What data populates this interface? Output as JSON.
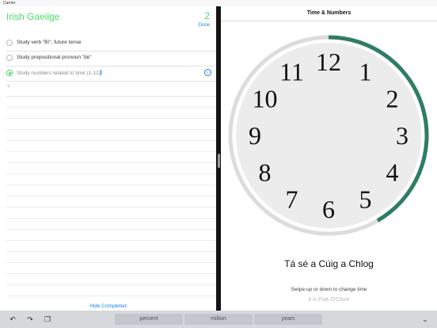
{
  "status_bar": {
    "carrier": "Carrier",
    "time": "",
    "battery": ""
  },
  "reminders": {
    "title": "Irish Gaeilge",
    "count": "2",
    "done_label": "Done",
    "items": [
      {
        "text": "Study verb \"Bí\", future tense",
        "state": "incomplete"
      },
      {
        "text": "Study prepositional pronoun \"de\"",
        "state": "incomplete"
      },
      {
        "text": "Study numbers related to time (1-12)",
        "state": "editing"
      }
    ],
    "add_icon": "plus-icon",
    "hide_completed_label": "Hide Completed"
  },
  "clock_pane": {
    "nav_title": "Time & Numbers",
    "hour_labels": [
      "12",
      "1",
      "2",
      "3",
      "4",
      "5",
      "6",
      "7",
      "8",
      "9",
      "10",
      "11"
    ],
    "progress_fraction": 0.4167,
    "irish_phrase": "Tá sé a Cúig a Chlog",
    "hint": "Swipe up or down to change time",
    "translation": "It is Five O'Clock",
    "colors": {
      "progress": "#2e7d64",
      "ring": "#dcdcdc",
      "face": "#ececec"
    }
  },
  "keyboard": {
    "undo_icon": "undo-icon",
    "redo_icon": "redo-icon",
    "paste_icon": "paste-icon",
    "suggestions": [
      "percent",
      "million",
      "years"
    ],
    "dismiss_icon": "chevron-down-icon"
  },
  "colors": {
    "accent_green": "#4cd964",
    "link_blue": "#1a7ef0"
  }
}
